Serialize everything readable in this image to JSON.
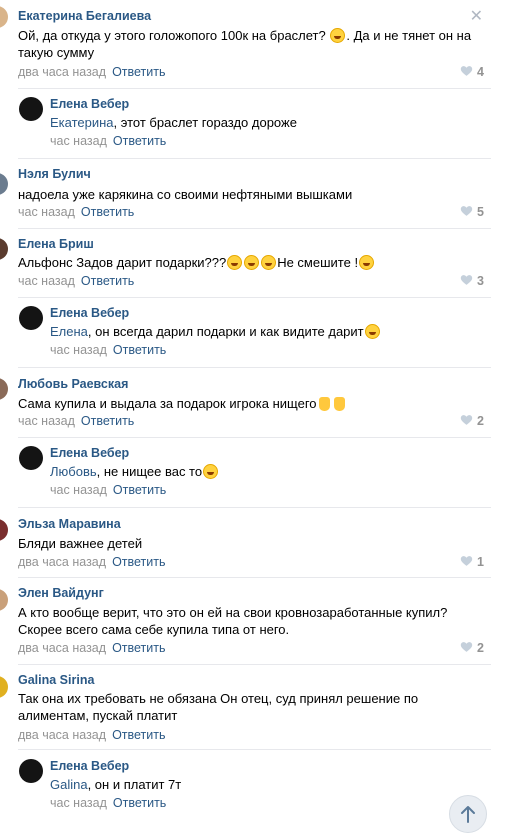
{
  "comments": [
    {
      "author": "Екатерина Бегалиева",
      "text": "Ой, да откуда у этого голожопого 100к на браслет? . Да и не тянет он на такую сумму",
      "text_part1": "Ой, да откуда у этого голожопого 100к на браслет? ",
      "text_part2": ". Да и не тянет он на такую сумму",
      "time": "два часа назад",
      "reply_label": "Ответить",
      "likes": "4",
      "close": "✕"
    },
    {
      "author": "Елена Вебер",
      "mention": "Екатерина",
      "text": ", этот браслет гораздо дороже",
      "time": "час назад",
      "reply_label": "Ответить"
    },
    {
      "author": "Нэля Булич",
      "text": "надоела уже карякина со своими нефтяными вышками",
      "time": "час назад",
      "reply_label": "Ответить",
      "likes": "5"
    },
    {
      "author": "Елена Бриш",
      "text_part1": "Альфонс Задов дарит подарки???",
      "text_part2": "Не смешите !",
      "time": "час назад",
      "reply_label": "Ответить",
      "likes": "3"
    },
    {
      "author": "Елена Вебер",
      "mention": "Елена",
      "text": ", он всегда дарил подарки и как видите дарит",
      "time": "час назад",
      "reply_label": "Ответить"
    },
    {
      "author": "Любовь Раевская",
      "text": "Сама купила и выдала за подарок игрока нищего",
      "time": "час назад",
      "reply_label": "Ответить",
      "likes": "2"
    },
    {
      "author": "Елена Вебер",
      "mention": "Любовь",
      "text": ", не нищее вас то",
      "time": "час назад",
      "reply_label": "Ответить"
    },
    {
      "author": "Эльза Маравина",
      "text": "Бляди важнее детей",
      "time": "два часа назад",
      "reply_label": "Ответить",
      "likes": "1"
    },
    {
      "author": "Элен Вайдунг",
      "text": "А кто вообще верит, что это он ей на свои кровнозаработанные купил? Скорее всего сама себе купила типа от него.",
      "time": "два часа назад",
      "reply_label": "Ответить",
      "likes": "2"
    },
    {
      "author": "Galina Sirina",
      "text": "Так она их требовать не обязана Он отец, суд принял решение по алиментам, пускай платит",
      "time": "два часа назад",
      "reply_label": "Ответить"
    },
    {
      "author": "Елена Вебер",
      "mention": "Galina",
      "text": ", он и платит 7т",
      "time": "час назад",
      "reply_label": "Ответить"
    }
  ],
  "colors": {
    "link": "#2a5885",
    "meta": "#939393",
    "divider": "#e7e8ec",
    "heart": "#c5d0db"
  },
  "icons": {
    "like": "heart-icon",
    "close": "close-icon",
    "scroll": "arrow-up-icon"
  }
}
